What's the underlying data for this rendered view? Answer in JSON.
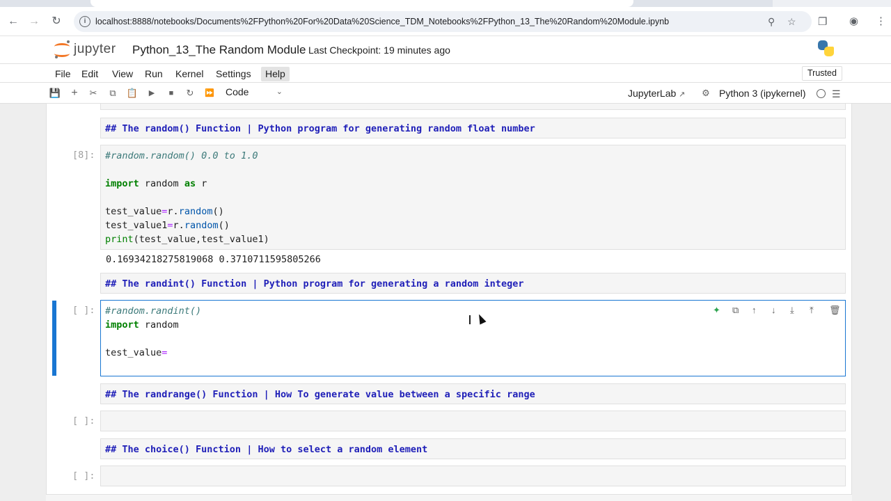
{
  "browser": {
    "url": "localhost:8888/notebooks/Documents%2FPython%20For%20Data%20Science_TDM_Notebooks%2FPython_13_The%20Random%20Module.ipynb",
    "icons": [
      "back-icon",
      "forward-icon",
      "reload-icon",
      "info-icon",
      "zoom-icon",
      "star-icon",
      "extensions-icon",
      "profile-icon",
      "menu-icon"
    ]
  },
  "header": {
    "app_name": "jupyter",
    "notebook_title": "Python_13_The Random Module",
    "checkpoint": "Last Checkpoint: 19 minutes ago"
  },
  "menu": {
    "items": [
      "File",
      "Edit",
      "View",
      "Run",
      "Kernel",
      "Settings",
      "Help"
    ],
    "active": "Help",
    "trusted": "Trusted"
  },
  "toolbar": {
    "cell_type": "Code",
    "jupyterlab_link": "JupyterLab",
    "kernel": "Python 3 (ipykernel)"
  },
  "cells": {
    "md1": "## The random() Function | Python program for generating random float number",
    "code1": {
      "prompt": "[8]:",
      "comment": "#random.random() 0.0 to 1.0",
      "output": "0.16934218275819068 0.3710711595805266"
    },
    "md2": "## The randint() Function | Python program for generating a random integer",
    "code2": {
      "prompt": "[ ]:",
      "comment": "#random.randint()"
    },
    "md3": "## The randrange() Function | How To generate value between a specific range",
    "code3": {
      "prompt": "[ ]:"
    },
    "md4": "## The choice() Function | How to select a random element",
    "code4": {
      "prompt": "[ ]:"
    }
  },
  "colors": {
    "accent": "#1976d2",
    "markdown_heading": "#1f1fb8",
    "keyword": "#008000",
    "comment": "#3d7a7a",
    "operator": "#aa22ff",
    "jupyter_orange": "#f37726"
  }
}
